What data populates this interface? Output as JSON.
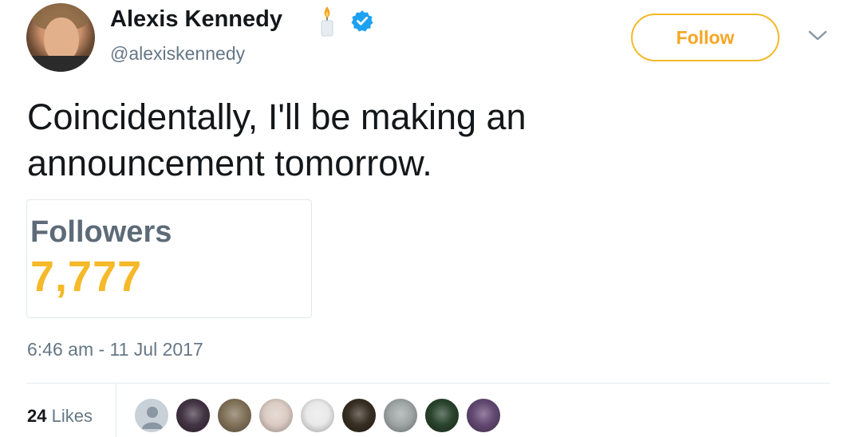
{
  "author": {
    "name": "Alexis Kennedy",
    "handle": "@alexiskennedy",
    "emoji": "candle-icon",
    "verified": true
  },
  "follow_button": {
    "label": "Follow",
    "color": "#f5a623"
  },
  "tweet": {
    "text": "Coincidentally, I'll be making an announcement tomorrow.",
    "timestamp": "6:46 am - 11 Jul 2017"
  },
  "card": {
    "label": "Followers",
    "value": "7,777",
    "label_color": "#5c6b77",
    "value_color": "#f5b929"
  },
  "stats": {
    "likes_count": "24",
    "likes_label": "Likes"
  },
  "likers": [
    {
      "icon": "default-profile-avatar",
      "color": "#c8d1d8"
    },
    {
      "icon": "red-abstract-avatar",
      "color": "#3a2a3a"
    },
    {
      "icon": "hooded-figure-avatar",
      "color": "#7a6a50"
    },
    {
      "icon": "cartoon-rat-avatar",
      "color": "#d9c9c0"
    },
    {
      "icon": "dark-figure-avatar",
      "color": "#e8e8e8"
    },
    {
      "icon": "skull-avatar",
      "color": "#2e2418"
    },
    {
      "icon": "screaming-face-avatar",
      "color": "#9aa0a0"
    },
    {
      "icon": "dark-creature-avatar",
      "color": "#1f3a22"
    },
    {
      "icon": "person-desk-avatar",
      "color": "#5a3f6a"
    }
  ]
}
